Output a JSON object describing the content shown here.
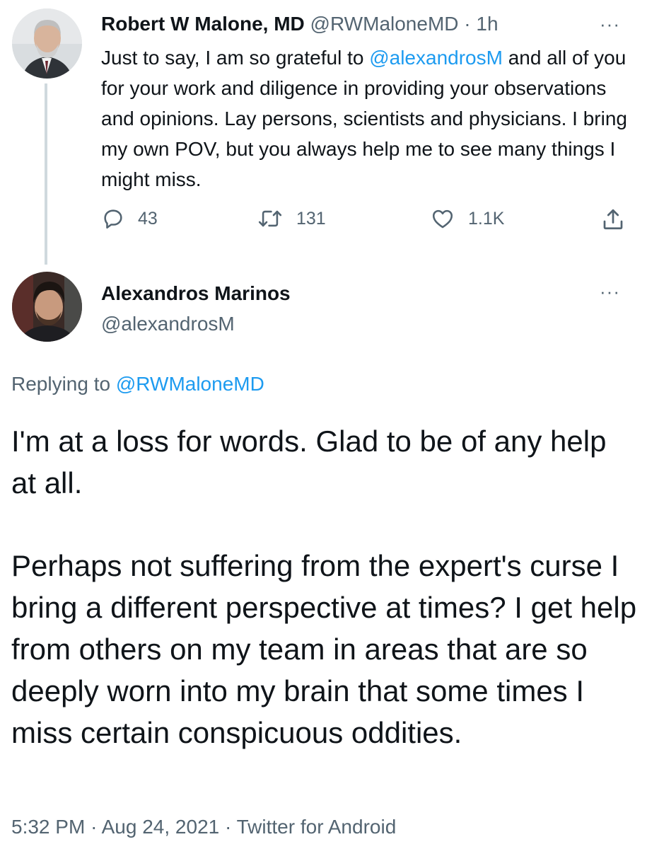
{
  "tweet1": {
    "name": "Robert W Malone, MD",
    "handle": "@RWMaloneMD",
    "separator": "·",
    "time": "1h",
    "more": "···",
    "text_prefix": "Just to say, I am so grateful to ",
    "mention": "@alexandrosM",
    "text_suffix": " and all of you for your work and diligence in providing your observations and opinions.  Lay persons, scientists and physicians.  I bring my own POV, but you always help me to see many things I might miss.",
    "actions": {
      "reply_icon": "reply-icon",
      "reply_count": "43",
      "retweet_icon": "retweet-icon",
      "retweet_count": "131",
      "like_icon": "heart-icon",
      "like_count": "1.1K",
      "share_icon": "share-icon"
    }
  },
  "tweet2": {
    "name": "Alexandros Marinos",
    "handle": "@alexandrosM",
    "more": "···",
    "replying_prefix": "Replying to ",
    "replying_handle": "@RWMaloneMD",
    "paragraph1": "I'm at a loss for words. Glad to be of any help at all.",
    "paragraph2": "Perhaps not suffering from the expert's curse I bring a different perspective at times? I get help from others on my team in areas that are so deeply worn into my brain that some times I miss certain conspicuous oddities.",
    "time": "5:32 PM",
    "date": "Aug 24, 2021",
    "source": "Twitter for Android",
    "separator": "·"
  },
  "colors": {
    "text": "#0f1419",
    "secondary": "#536471",
    "link": "#1d9bf0",
    "thread_line": "#cfd9de"
  }
}
